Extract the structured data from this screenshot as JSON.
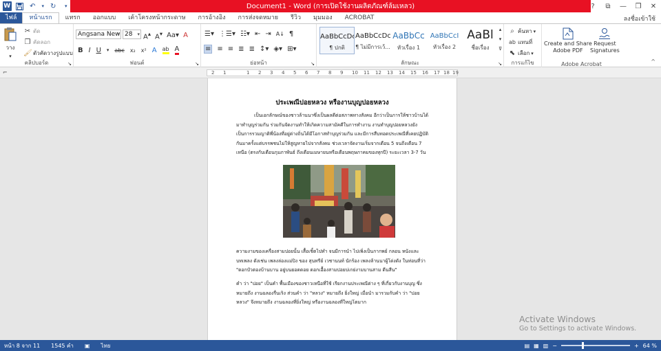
{
  "titlebar": {
    "title": "Document1 - Word (การเปิดใช้งานผลิตภัณฑ์ล้มเหลว)",
    "help": "?",
    "minimize": "—",
    "maximize": "❐",
    "close": "✕",
    "restore": "⧉"
  },
  "tabs": {
    "file": "ไฟล์",
    "items": [
      "หน้าแรก",
      "แทรก",
      "ออกแบบ",
      "เค้าโครงหน้ากระดาษ",
      "การอ้างอิง",
      "การส่งจดหมาย",
      "รีวิว",
      "มุมมอง",
      "ACROBAT"
    ],
    "user": "ลงชื่อเข้าใช้"
  },
  "ribbon": {
    "clipboard": {
      "paste": "วาง",
      "cut": "ตัด",
      "copy": "คัดลอก",
      "format_painter": "ตัวคัดวางรูปแบบ",
      "label": "คลิปบอร์ด"
    },
    "font": {
      "name": "Angsana New",
      "size": "28",
      "label": "ฟอนต์"
    },
    "paragraph": {
      "label": "ย่อหน้า"
    },
    "styles": {
      "items": [
        {
          "sample": "AaBbCcDc",
          "name": "¶ ปกติ"
        },
        {
          "sample": "AaBbCcDc",
          "name": "¶ ไม่มีการเว้..."
        },
        {
          "sample": "AaBbCc",
          "name": "หัวเรื่อง 1"
        },
        {
          "sample": "AaBbCcI",
          "name": "หัวเรื่อง 2"
        },
        {
          "sample": "AaBl",
          "name": "ชื่อเรื่อง"
        }
      ],
      "label": "ลักษณะ"
    },
    "editing": {
      "find": "ค้นหา",
      "replace": "แทนที่",
      "select": "เลือก",
      "label": "การแก้ไข"
    },
    "acrobat": {
      "create_share": "Create and Share",
      "create_share2": "Adobe PDF",
      "request": "Request",
      "request2": "Signatures",
      "label": "Adobe Acrobat"
    }
  },
  "ruler": {
    "ticks": [
      "2",
      "1",
      "1",
      "2",
      "3",
      "4",
      "5",
      "6",
      "7",
      "8",
      "9",
      "10",
      "11",
      "12",
      "13",
      "14",
      "15",
      "16",
      "17",
      "18",
      "19"
    ]
  },
  "document": {
    "title": "ประเพณีปอยหลวง หรืองานบุญปอยหลวง",
    "p1": "เป็นเอกลักษณ์ของชาวล้านนาซึ่งเป็นผลดีต่อสภาพทางสังคม อีกว่าเป็นการให้ชาวบ้านได้มาทำบุญร่วมกัน ร่วมกันจัดงานทำให้เกิดความสามัคคีในการทำงาน งานทำบุญปอยหลวงยังเป็นการรวมญาติพี่น้องที่อยู่ต่างถิ่นได้มีโอกาสทำบุญร่วมกัน และมีการสืบทอดประเพณีที่เคยปฏิบัติกันมาครั้งแต่บรรพชนไม่ให้สูญหายไปจากสังคม ช่วงเวลาจัดงานเริ่มจากเดือน 5 จนถึงเดือน 7 เหนือ (ตรงกับเดือนกุมภาพันธ์ ถึงเดือนเมษายนหรือเดือนพฤษภาคมของทุกปี) ระยะเวลา 3-7 วัน",
    "p2": "ความงามของเครื่องสามปอยนั้น เสื้อเชิ้ตไปทำ จนมีการนำ ไปเพิ่งเป็นกากพย์ กลอน หนังและบทเพลง ดังเช่น เพลงล่องแม่ปิง ของ สุนทรีย์ เวชานนท์ นักร้อง เพลงล้านนาผู้โด่งดัง ในท่อนที่ว่า \"ดอกบัวตองบ้านบาน อยู่บนยอดดอย ดอกเอื้องสามปอยบ่เกย่งามบานสาม ดีนสีน\"",
    "p3": "คำ ว่า \"ปอย\" เป็นคำ พื้นเมืองของชาวเหนือที่ใช้ เรียกงานประเพณีต่าง ๆ ที่เกี่ยวกับงานบุญ ซึ่งหมายถึง งานฉลองรื่นเริง ส่วนคำ ว่า \"หลวง\" หมายถึง ยิ่งใหญ่ เมื่อนำ มารวมกับคำ ว่า \"ปอยหลวง\" จึงหมายถึง งานฉลองที่ยิ่งใหญ่ หรืองานฉลองที่ใหญ่โตมาก"
  },
  "activate": {
    "line1": "Activate Windows",
    "line2": "Go to Settings to activate Windows."
  },
  "status": {
    "page": "หน้า 8 จาก 11",
    "words": "1545 คำ",
    "lang": "ไทย",
    "zoom": "64 %"
  },
  "colors": {
    "brand": "#2b579a",
    "title_red": "#e81123"
  }
}
